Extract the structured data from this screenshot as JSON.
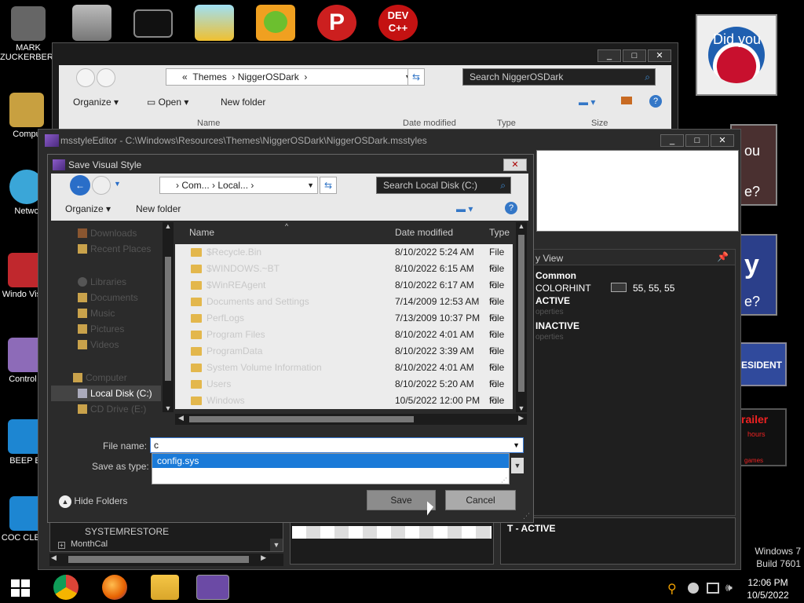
{
  "desktop": {
    "icons": [
      {
        "label": "MARK ZUCKERBERG",
        "icon": "zuckerberg-icon"
      },
      {
        "label": "Compu",
        "icon": "computer-icon"
      },
      {
        "label": "Netwo",
        "icon": "network-icon"
      },
      {
        "label": "Windo Vista",
        "icon": "windows-vista-icon"
      },
      {
        "label": "Control I",
        "icon": "control-panel-icon"
      },
      {
        "label": "BEEP B",
        "icon": "beep-icon"
      },
      {
        "label": "COC CLEAN",
        "icon": "cleaner-icon"
      }
    ],
    "right_tiles": {
      "did_you": "Did you",
      "you": "ou",
      "e_q": "e?",
      "e_q2": "e?",
      "resident": "ESIDENT",
      "trailer": "railer",
      "hours": "hours",
      "games": "games"
    },
    "watermark": {
      "line1": "Windows 7",
      "line2": "Build 7601"
    }
  },
  "explorer": {
    "address": [
      "«",
      "Themes",
      "NiggerOSDark"
    ],
    "search_placeholder": "Search NiggerOSDark",
    "toolbar": {
      "organize": "Organize",
      "open": "Open",
      "new_folder": "New folder"
    },
    "columns": {
      "name": "Name",
      "date": "Date modified",
      "type": "Type",
      "size": "Size"
    }
  },
  "msstyle": {
    "title": "msstyleEditor - C:\\Windows\\Resources\\Themes\\NiggerOSDark\\NiggerOSDark.msstyles",
    "view_label": "y View",
    "props": {
      "common": "Common",
      "colorhint": "COLORHINT",
      "colorhint_value": "55, 55, 55",
      "active": "ACTIVE",
      "active_sub": "operties",
      "inactive": "INACTIVE",
      "inactive_sub": "operties"
    },
    "tree": {
      "systemrestore": "SYSTEMRESTORE",
      "monthcal": "MonthCal"
    },
    "bottom_label": "T - ACTIVE"
  },
  "dialog": {
    "title": "Save Visual Style",
    "address": [
      "Com...",
      "Local..."
    ],
    "search_placeholder": "Search Local Disk (C:)",
    "organize": "Organize",
    "new_folder": "New folder",
    "columns": {
      "name": "Name",
      "date": "Date modified",
      "type": "Type"
    },
    "nav": [
      {
        "label": "Downloads",
        "icon": "downloads-icon"
      },
      {
        "label": "Recent Places",
        "icon": "recent-places-icon"
      },
      {
        "label": "Libraries",
        "icon": "libraries-icon"
      },
      {
        "label": "Documents",
        "icon": "documents-icon"
      },
      {
        "label": "Music",
        "icon": "music-icon"
      },
      {
        "label": "Pictures",
        "icon": "pictures-icon"
      },
      {
        "label": "Videos",
        "icon": "videos-icon"
      },
      {
        "label": "Computer",
        "icon": "computer-icon"
      },
      {
        "label": "Local Disk (C:)",
        "icon": "local-disk-icon"
      },
      {
        "label": "CD Drive (E:)",
        "icon": "cd-drive-icon"
      }
    ],
    "files": [
      {
        "name": "$Recycle.Bin",
        "date": "8/10/2022 5:24 AM",
        "type": "File fo"
      },
      {
        "name": "$WINDOWS.~BT",
        "date": "8/10/2022 6:15 AM",
        "type": "File fo"
      },
      {
        "name": "$WinREAgent",
        "date": "8/10/2022 6:17 AM",
        "type": "File fo"
      },
      {
        "name": "Documents and Settings",
        "date": "7/14/2009 12:53 AM",
        "type": "File fo"
      },
      {
        "name": "PerfLogs",
        "date": "7/13/2009 10:37 PM",
        "type": "File fo"
      },
      {
        "name": "Program Files",
        "date": "8/10/2022 4:01 AM",
        "type": "File fo"
      },
      {
        "name": "ProgramData",
        "date": "8/10/2022 3:39 AM",
        "type": "File fo"
      },
      {
        "name": "System Volume Information",
        "date": "8/10/2022 4:01 AM",
        "type": "File fo"
      },
      {
        "name": "Users",
        "date": "8/10/2022 5:20 AM",
        "type": "File fo"
      },
      {
        "name": "Windows",
        "date": "10/5/2022 12:00 PM",
        "type": "File fo"
      }
    ],
    "file_name_label": "File name:",
    "file_name_value": "c",
    "autocomplete": "config.sys",
    "save_type_label": "Save as type:",
    "hide_folders": "Hide Folders",
    "save": "Save",
    "cancel": "Cancel"
  },
  "taskbar": {
    "time": "12:06 PM",
    "date": "10/5/2022"
  }
}
